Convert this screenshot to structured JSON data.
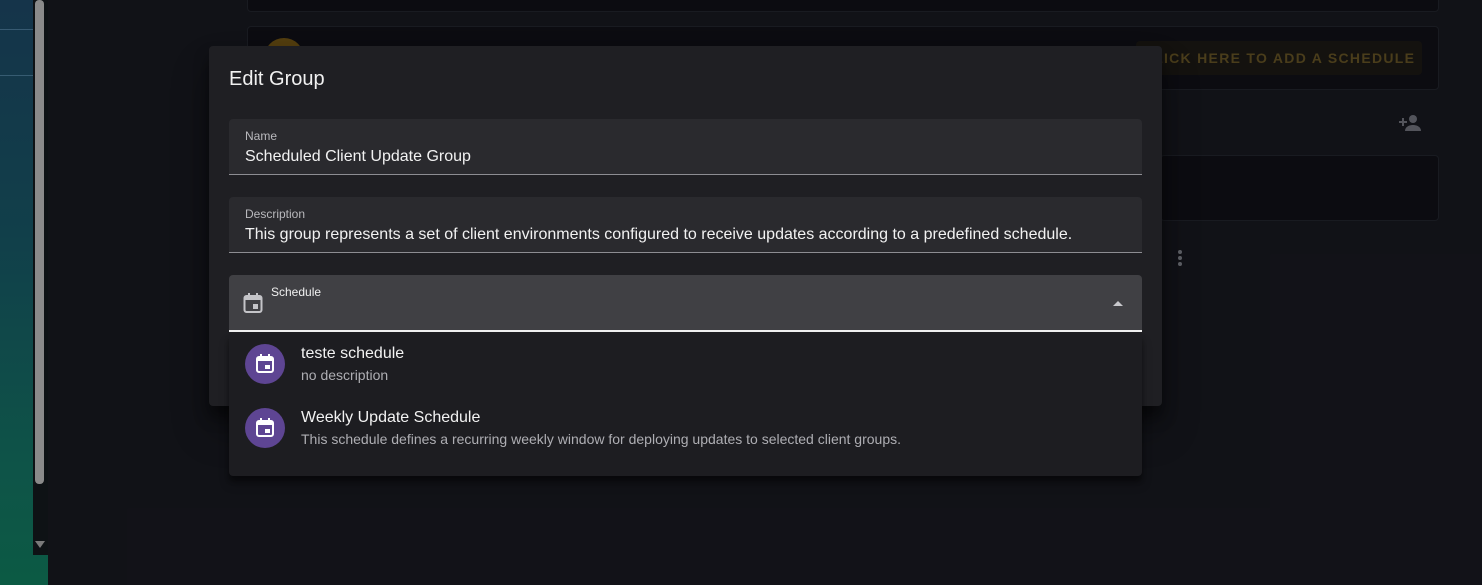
{
  "background": {
    "add_schedule_label": "CLICK HERE TO ADD A SCHEDULE",
    "add_user_icon": "person-add-icon",
    "more_icon": "more-vertical-icon"
  },
  "dialog": {
    "title": "Edit Group",
    "name_field": {
      "label": "Name",
      "value": "Scheduled Client Update Group"
    },
    "description_field": {
      "label": "Description",
      "value": "This group represents a set of client environments configured to receive updates according to a predefined schedule."
    },
    "schedule_select": {
      "label": "Schedule",
      "icon": "calendar-icon",
      "expanded": true
    }
  },
  "schedule_menu": {
    "options": [
      {
        "title": "teste schedule",
        "subtitle": "no description",
        "icon": "calendar-icon"
      },
      {
        "title": "Weekly Update Schedule",
        "subtitle": "This schedule defines a recurring weekly window for deploying updates to selected client groups.",
        "icon": "calendar-icon"
      }
    ]
  },
  "colors": {
    "accent_purple": "#5e4593",
    "surface": "#1f1f23",
    "field": "#2a2a2e",
    "select_active": "#404044"
  }
}
